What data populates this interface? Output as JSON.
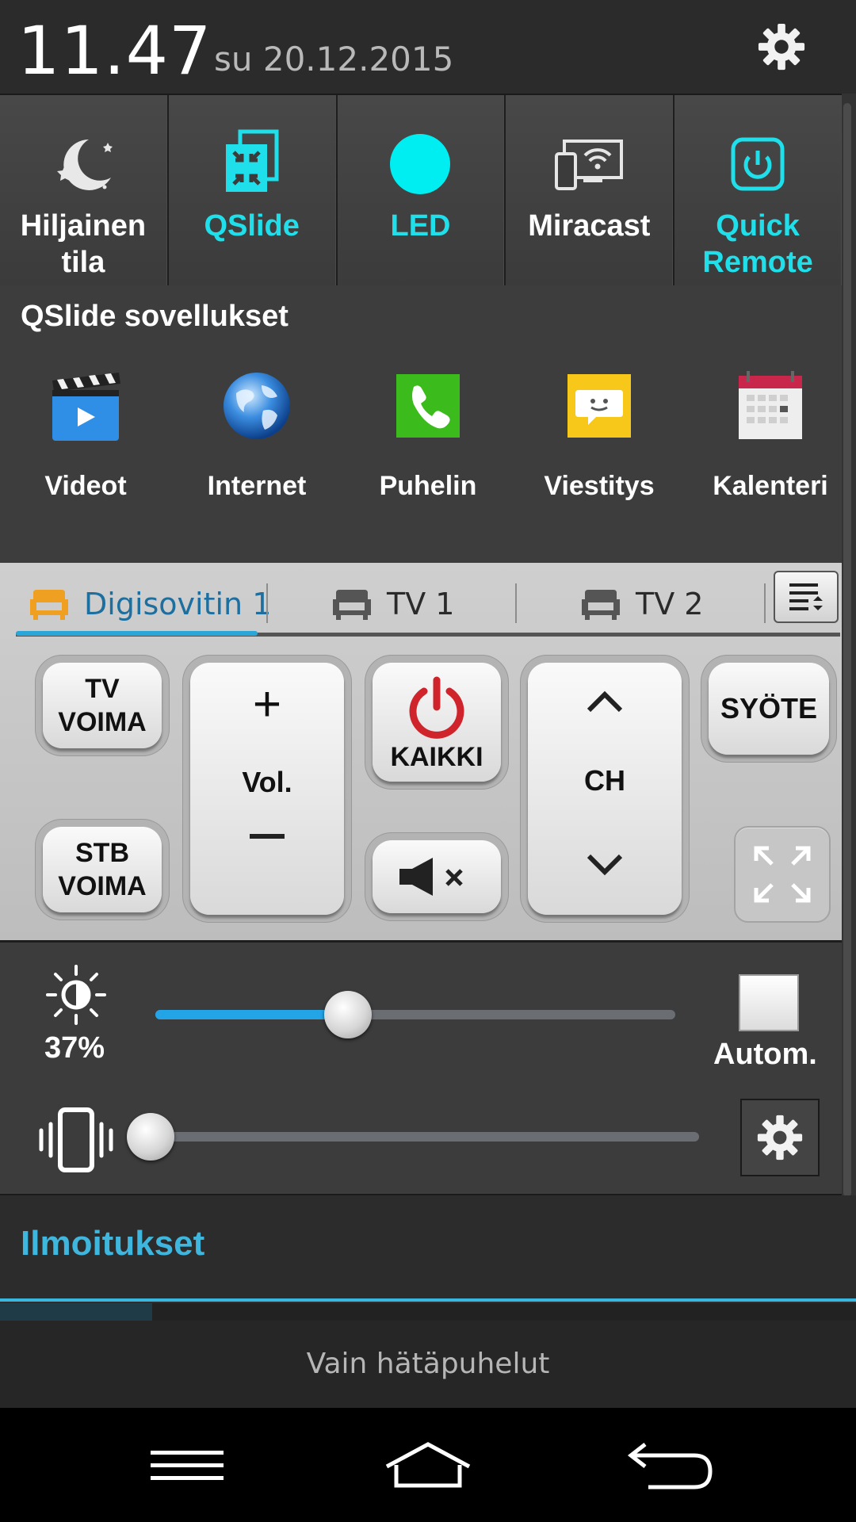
{
  "header": {
    "time": "11.47",
    "date": "su 20.12.2015",
    "settings_icon": "gear-icon"
  },
  "toggles": [
    {
      "label_l1": "Hiljainen",
      "label_l2": "tila",
      "icon": "moon-icon",
      "active": false
    },
    {
      "label_l1": "QSlide",
      "label_l2": "",
      "icon": "qslide-icon",
      "active": true
    },
    {
      "label_l1": "LED",
      "label_l2": "",
      "icon": "led-icon",
      "active": true
    },
    {
      "label_l1": "Miracast",
      "label_l2": "",
      "icon": "miracast-icon",
      "active": false
    },
    {
      "label_l1": "Quick",
      "label_l2": "Remote",
      "icon": "quick-remote-icon",
      "active": true
    }
  ],
  "qslide": {
    "title": "QSlide sovellukset",
    "apps": [
      {
        "label": "Videot",
        "icon": "video-clapper-icon"
      },
      {
        "label": "Internet",
        "icon": "globe-icon"
      },
      {
        "label": "Puhelin",
        "icon": "phone-icon"
      },
      {
        "label": "Viestitys",
        "icon": "message-icon"
      },
      {
        "label": "Kalenteri",
        "icon": "calendar-icon"
      }
    ]
  },
  "remote": {
    "tabs": [
      {
        "label": "Digisovitin 1",
        "active": true
      },
      {
        "label": "TV 1",
        "active": false
      },
      {
        "label": "TV 2",
        "active": false
      }
    ],
    "buttons": {
      "tv_power_l1": "TV",
      "tv_power_l2": "VOIMA",
      "stb_power_l1": "STB",
      "stb_power_l2": "VOIMA",
      "vol_plus": "+",
      "vol": "Vol.",
      "power_all": "KAIKKI",
      "ch": "CH",
      "input": "SYÖTE"
    },
    "colors": {
      "active_tab": "#1d6fa0",
      "active_underline": "#2aa6d8",
      "sofa_active": "#f0a020",
      "power_red": "#d0242c"
    }
  },
  "brightness": {
    "percent_label": "37%",
    "value": 0.37,
    "auto_label": "Autom.",
    "auto_checked": false
  },
  "volume": {
    "value": 0.0
  },
  "notifications": {
    "title": "Ilmoitukset",
    "emergency": "Vain hätäpuhelut"
  },
  "colors": {
    "accent_cyan": "#1fe0ea",
    "slider_blue": "#23a4e6",
    "notif_title": "#3fb6dd"
  }
}
